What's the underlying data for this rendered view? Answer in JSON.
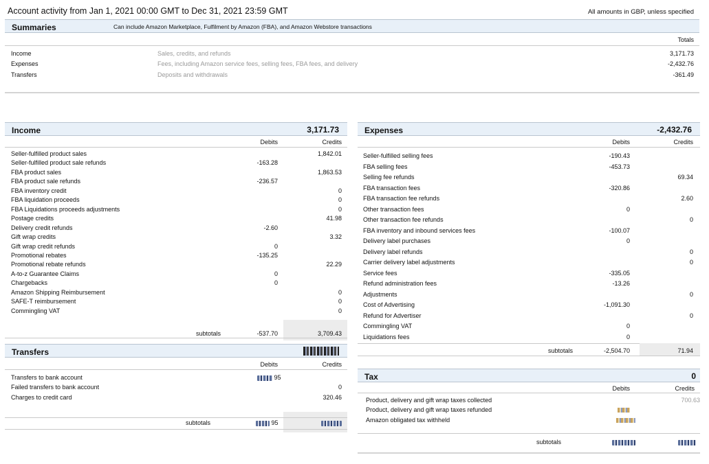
{
  "header": {
    "title": "Account activity from Jan 1, 2021 00:00 GMT to Dec 31, 2021 23:59 GMT",
    "currency_note": "All amounts in GBP, unless specified"
  },
  "summaries": {
    "title": "Summaries",
    "subtitle": "Can include Amazon Marketplace, Fulfilment by Amazon (FBA), and Amazon Webstore transactions",
    "totals_label": "Totals",
    "rows": [
      {
        "label": "Income",
        "desc": "Sales, credits, and refunds",
        "total": "3,171.73"
      },
      {
        "label": "Expenses",
        "desc": "Fees, including Amazon service fees, selling fees, FBA fees, and delivery",
        "total": "-2,432.76"
      },
      {
        "label": "Transfers",
        "desc": "Deposits and withdrawals",
        "total": "-361.49"
      }
    ]
  },
  "income": {
    "title": "Income",
    "total": "3,171.73",
    "debits_label": "Debits",
    "credits_label": "Credits",
    "rows": [
      {
        "label": "Seller-fulfilled product sales",
        "debit": "",
        "credit": "1,842.01"
      },
      {
        "label": "Seller-fulfilled product sale refunds",
        "debit": "-163.28",
        "credit": ""
      },
      {
        "label": "FBA product sales",
        "debit": "",
        "credit": "1,863.53"
      },
      {
        "label": "FBA product sale refunds",
        "debit": "-236.57",
        "credit": ""
      },
      {
        "label": "FBA inventory credit",
        "debit": "",
        "credit": "0"
      },
      {
        "label": "FBA liquidation proceeds",
        "debit": "",
        "credit": "0"
      },
      {
        "label": "FBA Liquidations proceeds adjustments",
        "debit": "",
        "credit": "0"
      },
      {
        "label": "Postage credits",
        "debit": "",
        "credit": "41.98"
      },
      {
        "label": "Delivery credit refunds",
        "debit": "-2.60",
        "credit": ""
      },
      {
        "label": "Gift wrap credits",
        "debit": "",
        "credit": "3.32"
      },
      {
        "label": "Gift wrap credit refunds",
        "debit": "0",
        "credit": ""
      },
      {
        "label": "Promotional rebates",
        "debit": "-135.25",
        "credit": ""
      },
      {
        "label": "Promotional rebate refunds",
        "debit": "",
        "credit": "22.29"
      },
      {
        "label": "A-to-z Guarantee Claims",
        "debit": "0",
        "credit": ""
      },
      {
        "label": "Chargebacks",
        "debit": "0",
        "credit": ""
      },
      {
        "label": "Amazon Shipping Reimbursement",
        "debit": "",
        "credit": "0"
      },
      {
        "label": "SAFE-T reimbursement",
        "debit": "",
        "credit": "0"
      },
      {
        "label": "Commingling VAT",
        "debit": "",
        "credit": "0"
      }
    ],
    "subtotals_label": "subtotals",
    "subtotal_debit": "-537.70",
    "subtotal_credit": "3,709.43"
  },
  "transfers": {
    "title": "Transfers",
    "total": "-361.49",
    "debits_label": "Debits",
    "credits_label": "Credits",
    "rows": [
      {
        "label": "Transfers to bank account",
        "debit": "-681.95",
        "credit": ""
      },
      {
        "label": "Failed transfers to bank account",
        "debit": "",
        "credit": "0"
      },
      {
        "label": "Charges to credit card",
        "debit": "",
        "credit": "320.46"
      }
    ],
    "subtotals_label": "subtotals",
    "subtotal_debit": "-681.95",
    "subtotal_credit": "320.46"
  },
  "expenses": {
    "title": "Expenses",
    "total": "-2,432.76",
    "debits_label": "Debits",
    "credits_label": "Credits",
    "rows": [
      {
        "label": "Seller-fulfilled selling fees",
        "debit": "-190.43",
        "credit": ""
      },
      {
        "label": "FBA selling fees",
        "debit": "-453.73",
        "credit": ""
      },
      {
        "label": "Selling fee refunds",
        "debit": "",
        "credit": "69.34"
      },
      {
        "label": "FBA transaction fees",
        "debit": "-320.86",
        "credit": ""
      },
      {
        "label": "FBA transaction fee refunds",
        "debit": "",
        "credit": "2.60"
      },
      {
        "label": "Other transaction fees",
        "debit": "0",
        "credit": ""
      },
      {
        "label": "Other transaction fee refunds",
        "debit": "",
        "credit": "0"
      },
      {
        "label": "FBA inventory and inbound services fees",
        "debit": "-100.07",
        "credit": ""
      },
      {
        "label": "Delivery label purchases",
        "debit": "0",
        "credit": ""
      },
      {
        "label": "Delivery label refunds",
        "debit": "",
        "credit": "0"
      },
      {
        "label": "Carrier delivery label adjustments",
        "debit": "",
        "credit": "0"
      },
      {
        "label": "Service fees",
        "debit": "-335.05",
        "credit": ""
      },
      {
        "label": "Refund administration fees",
        "debit": "-13.26",
        "credit": ""
      },
      {
        "label": "Adjustments",
        "debit": "",
        "credit": "0"
      },
      {
        "label": "Cost of Advertising",
        "debit": "-1,091.30",
        "credit": ""
      },
      {
        "label": "Refund for Advertiser",
        "debit": "",
        "credit": "0"
      },
      {
        "label": "Commingling VAT",
        "debit": "0",
        "credit": ""
      },
      {
        "label": "Liquidations fees",
        "debit": "0",
        "credit": ""
      }
    ],
    "subtotals_label": "subtotals",
    "subtotal_debit": "-2,504.70",
    "subtotal_credit": "71.94"
  },
  "tax": {
    "title": "Tax",
    "total": "0",
    "debits_label": "Debits",
    "credits_label": "Credits",
    "rows": [
      {
        "label": "Product, delivery and gift wrap taxes collected",
        "debit": "",
        "credit": "700.63"
      },
      {
        "label": "Product, delivery and gift wrap taxes refunded",
        "debit": "-62.81",
        "credit": ""
      },
      {
        "label": "Amazon obligated tax withheld",
        "debit": "-637.82",
        "credit": ""
      }
    ],
    "subtotals_label": "subtotals",
    "subtotal_debit": "-700.63",
    "subtotal_credit": "700.63"
  }
}
